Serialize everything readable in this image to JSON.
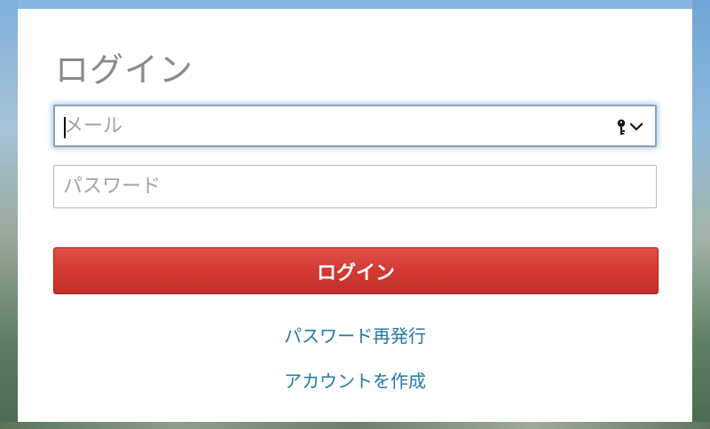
{
  "login_form": {
    "title": "ログイン",
    "email": {
      "placeholder": "メール",
      "value": ""
    },
    "password": {
      "placeholder": "パスワード",
      "value": ""
    },
    "submit_label": "ログイン",
    "reset_password_link": "パスワード再発行",
    "create_account_link": "アカウントを作成"
  },
  "icons": {
    "password_manager": "key-icon",
    "dropdown": "chevron-down-icon"
  },
  "colors": {
    "button": "#d33c35",
    "link": "#2479a6",
    "title": "#8a8a8a",
    "focus_border": "#8aa3b4"
  }
}
